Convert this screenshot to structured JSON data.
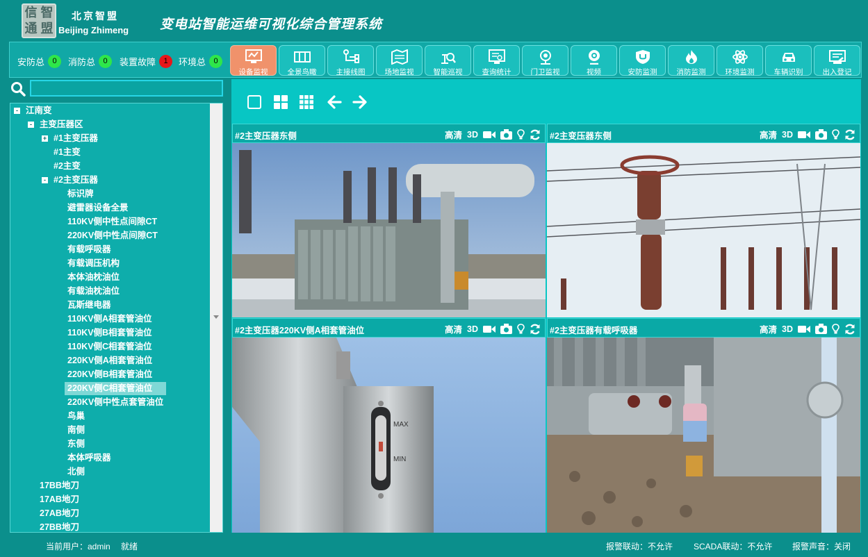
{
  "header": {
    "logo_chars": [
      "信",
      "智",
      "通",
      "盟"
    ],
    "company_cn": "北京智盟",
    "company_en": "Beijing Zhimeng",
    "system_title": "变电站智能运维可视化综合管理系统"
  },
  "status": [
    {
      "label": "安防总",
      "count": "0",
      "color": "#2ee64a"
    },
    {
      "label": "消防总",
      "count": "0",
      "color": "#2ee64a"
    },
    {
      "label": "装置故障",
      "count": "1",
      "color": "#e6161a"
    },
    {
      "label": "环境总",
      "count": "0",
      "color": "#2ee64a"
    }
  ],
  "modules": [
    {
      "label": "设备监视",
      "icon": "monitor-icon",
      "active": true
    },
    {
      "label": "全景鸟瞰",
      "icon": "panorama-icon"
    },
    {
      "label": "主接线图",
      "icon": "wiring-diagram-icon"
    },
    {
      "label": "场地监视",
      "icon": "site-map-icon"
    },
    {
      "label": "智能巡视",
      "icon": "patrol-search-icon"
    },
    {
      "label": "查询统计",
      "icon": "statistics-icon"
    },
    {
      "label": "门卫监视",
      "icon": "gate-camera-icon"
    },
    {
      "label": "视频",
      "icon": "webcam-icon"
    },
    {
      "label": "安防监测",
      "icon": "shield-icon"
    },
    {
      "label": "消防监测",
      "icon": "fire-icon"
    },
    {
      "label": "环境监测",
      "icon": "atom-icon"
    },
    {
      "label": "车辆识别",
      "icon": "car-icon"
    },
    {
      "label": "出入登记",
      "icon": "register-icon"
    }
  ],
  "search": {
    "value": "",
    "placeholder": ""
  },
  "tree": [
    {
      "label": "江南变",
      "level": 0,
      "toggle": "-"
    },
    {
      "label": "主变压器区",
      "level": 1,
      "toggle": "-"
    },
    {
      "label": "#1主变压器",
      "level": 2,
      "toggle": "+"
    },
    {
      "label": "#1主变",
      "level": 2
    },
    {
      "label": "#2主变",
      "level": 2
    },
    {
      "label": "#2主变压器",
      "level": 2,
      "toggle": "-"
    },
    {
      "label": "标识牌",
      "level": 3
    },
    {
      "label": "避雷器设备全景",
      "level": 3
    },
    {
      "label": "110KV侧中性点间隙CT",
      "level": 3
    },
    {
      "label": "220KV侧中性点间隙CT",
      "level": 3
    },
    {
      "label": "有载呼吸器",
      "level": 3
    },
    {
      "label": "有载调压机构",
      "level": 3
    },
    {
      "label": "本体油枕油位",
      "level": 3
    },
    {
      "label": "有载油枕油位",
      "level": 3
    },
    {
      "label": "瓦斯继电器",
      "level": 3
    },
    {
      "label": "110KV侧A相套管油位",
      "level": 3
    },
    {
      "label": "110KV侧B相套管油位",
      "level": 3
    },
    {
      "label": "110KV侧C相套管油位",
      "level": 3
    },
    {
      "label": "220KV侧A相套管油位",
      "level": 3
    },
    {
      "label": "220KV侧B相套管油位",
      "level": 3
    },
    {
      "label": "220KV侧C相套管油位",
      "level": 3,
      "selected": true
    },
    {
      "label": "220KV侧中性点套管油位",
      "level": 3
    },
    {
      "label": "鸟巢",
      "level": 3
    },
    {
      "label": "南侧",
      "level": 3
    },
    {
      "label": "东侧",
      "level": 3
    },
    {
      "label": "本体呼吸器",
      "level": 3
    },
    {
      "label": "北侧",
      "level": 3
    },
    {
      "label": "17BB地刀",
      "level": 1
    },
    {
      "label": "17AB地刀",
      "level": 1
    },
    {
      "label": "27AB地刀",
      "level": 1
    },
    {
      "label": "27BB地刀",
      "level": 1
    }
  ],
  "cameras": [
    {
      "title": "#2主变压器东侧",
      "quality": "高清",
      "mode": "3D"
    },
    {
      "title": "#2主变压器东侧",
      "quality": "高清",
      "mode": "3D"
    },
    {
      "title": "#2主变压器220KV侧A相套管油位",
      "quality": "高清",
      "mode": "3D"
    },
    {
      "title": "#2主变压器有载呼吸器",
      "quality": "高清",
      "mode": "3D"
    }
  ],
  "gauge_labels": {
    "max": "MAX",
    "min": "MIN"
  },
  "footer": {
    "user": "当前用户：admin",
    "state": "就绪",
    "alarm_link": "报警联动：不允许",
    "scada_link": "SCADA联动：不允许",
    "alarm_sound": "报警声音：关闭"
  },
  "colors": {
    "accent": "#0b8f8c",
    "active_module": "#f0926b",
    "ok": "#2ee64a",
    "fault": "#e6161a"
  }
}
